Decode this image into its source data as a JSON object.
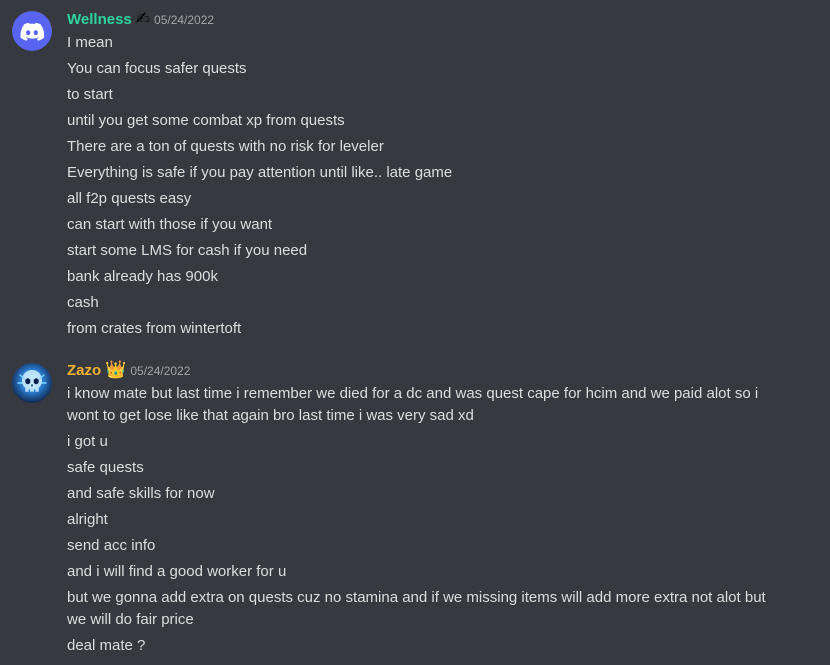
{
  "messages": [
    {
      "author": "Wellness",
      "author_color": "#2dd4a0",
      "badge": "✍",
      "timestamp": "05/24/2022",
      "avatar_icon": "discord-logo-icon",
      "lines": [
        "I mean",
        "You can focus safer quests",
        "to start",
        "until you get some combat xp from quests",
        "There are a ton of quests with no risk for leveler",
        "Everything is safe if you pay attention until like.. late game",
        "all f2p quests easy",
        "can start with those if you want",
        "start some LMS for cash if you need",
        "bank already has 900k",
        "cash",
        "from crates from wintertoft"
      ]
    },
    {
      "author": "Zazo",
      "author_color": "#f0b232",
      "badge": "👑",
      "timestamp": "05/24/2022",
      "avatar_icon": "blue-skull-avatar-icon",
      "lines": [
        "i know mate but last time i remember we died  for a dc and was quest cape for hcim and we paid alot so i wont to get lose like that again bro last time i was very sad xd",
        "i got u",
        "safe quests",
        "and safe skills for now",
        "alright",
        "send acc info",
        "and i will find a good worker for u",
        "but we gonna add extra on quests cuz no stamina and if we missing items will add more extra not alot but we will do fair price",
        "deal mate ?"
      ]
    }
  ]
}
